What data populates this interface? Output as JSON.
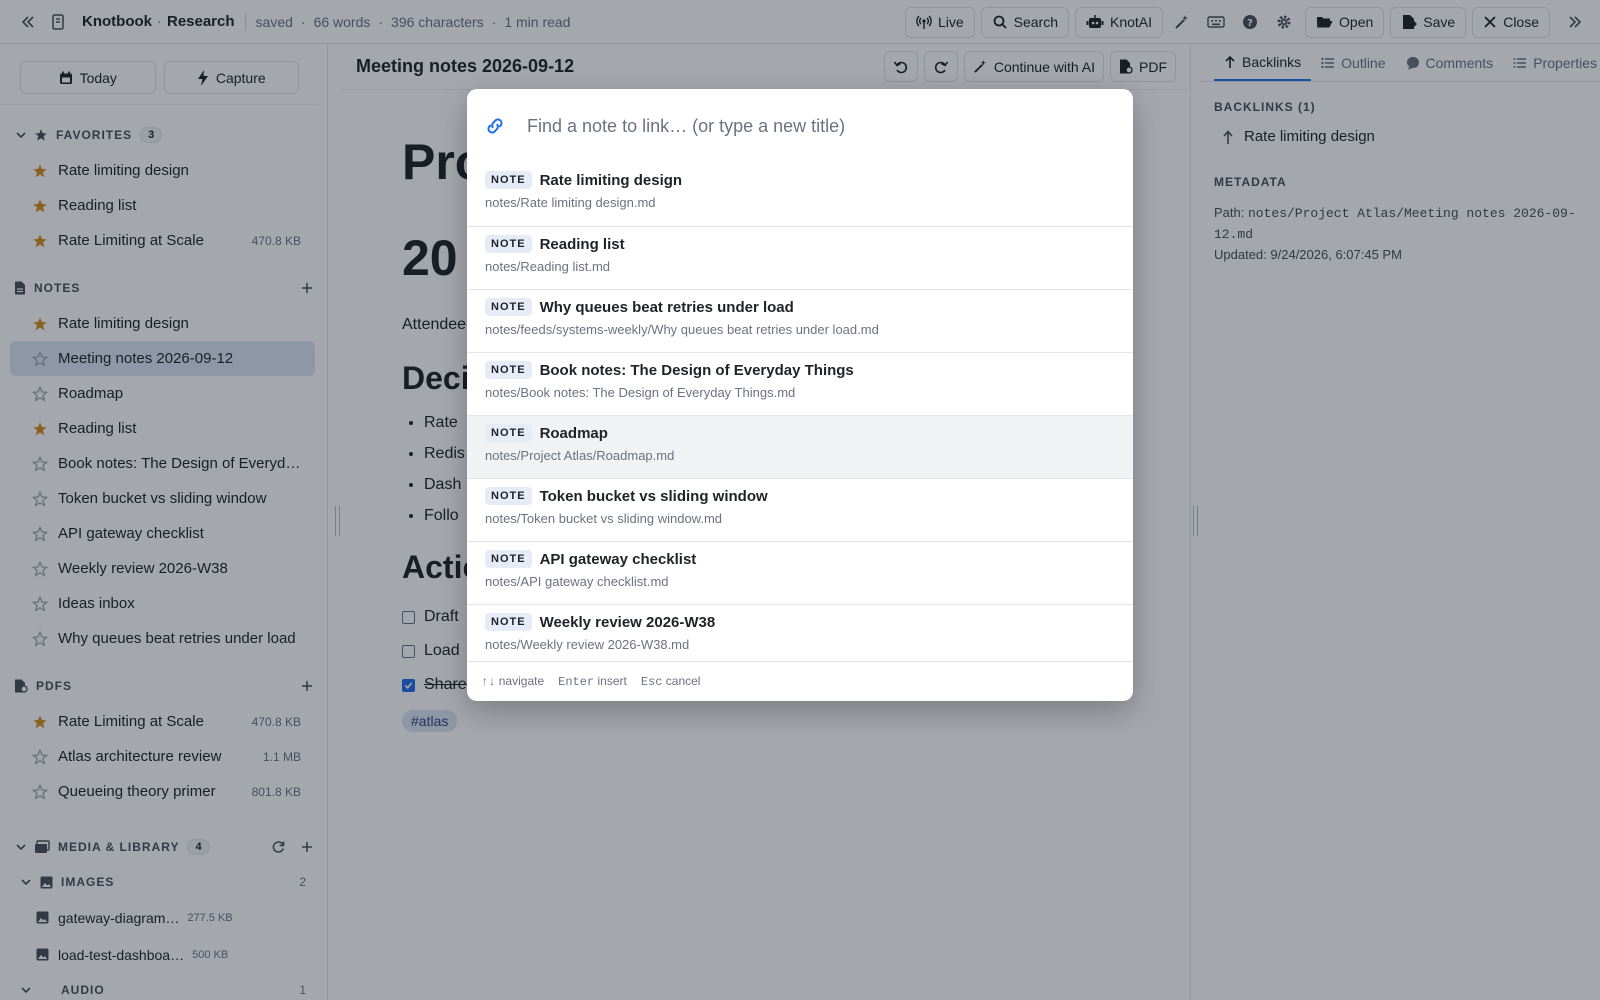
{
  "app": {
    "name": "Knotbook",
    "workspace": "Research",
    "stats": [
      "saved",
      "66 words",
      "396 characters",
      "1 min read"
    ]
  },
  "topbar": {
    "live_label": "Live",
    "search_label": "Search",
    "ai_label": "KnotAI",
    "open_label": "Open",
    "save_label": "Save",
    "close_label": "Close"
  },
  "sidebar": {
    "today_label": "Today",
    "capture_label": "Capture",
    "favorites": {
      "title": "FAVORITES",
      "count": "3",
      "items": [
        {
          "label": "Rate limiting design",
          "size": "",
          "starred": true
        },
        {
          "label": "Reading list",
          "size": "",
          "starred": true
        },
        {
          "label": "Rate Limiting at Scale",
          "size": "470.8 KB",
          "starred": true
        }
      ]
    },
    "notes": {
      "title": "NOTES",
      "items": [
        {
          "label": "Rate limiting design",
          "starred": true
        },
        {
          "label": "Meeting notes 2026-09-12",
          "starred": false,
          "active": true
        },
        {
          "label": "Roadmap",
          "starred": false
        },
        {
          "label": "Reading list",
          "starred": true
        },
        {
          "label": "Book notes: The Design of Everyday Things",
          "starred": false
        },
        {
          "label": "Token bucket vs sliding window",
          "starred": false
        },
        {
          "label": "API gateway checklist",
          "starred": false
        },
        {
          "label": "Weekly review 2026-W38",
          "starred": false
        },
        {
          "label": "Ideas inbox",
          "starred": false
        },
        {
          "label": "Why queues beat retries under load",
          "starred": false
        }
      ]
    },
    "pdfs": {
      "title": "PDFS",
      "items": [
        {
          "label": "Rate Limiting at Scale",
          "size": "470.8 KB",
          "starred": true
        },
        {
          "label": "Atlas architecture review",
          "size": "1.1 MB",
          "starred": false
        },
        {
          "label": "Queueing theory primer",
          "size": "801.8 KB",
          "starred": false
        }
      ]
    },
    "media": {
      "title": "MEDIA & LIBRARY",
      "count": "4",
      "images": {
        "title": "IMAGES",
        "count": "2",
        "items": [
          {
            "label": "gateway-diagram…",
            "size": "277.5 KB"
          },
          {
            "label": "load-test-dashboa…",
            "size": "500 KB"
          }
        ]
      },
      "audio": {
        "title": "AUDIO",
        "count": "1"
      }
    }
  },
  "main": {
    "title": "Meeting notes 2026-09-12",
    "continue_ai_label": "Continue with AI",
    "pdf_label": "PDF",
    "doc": {
      "h1_line1": "Pro",
      "h1_line2": "20",
      "attendees": "Attendee",
      "decisions_heading": "Deci",
      "bullets": [
        "Rate",
        "Redis",
        "Dash",
        "Follo"
      ],
      "actions_heading": "Actio",
      "tasks": [
        {
          "label": "Draft",
          "done": false
        },
        {
          "label": "Load",
          "done": false
        },
        {
          "label": "Share",
          "done": true
        }
      ],
      "tag": "#atlas"
    }
  },
  "right_panel": {
    "tabs": [
      "Backlinks",
      "Outline",
      "Comments",
      "Properties"
    ],
    "backlinks_title": "BACKLINKS (1)",
    "backlinks": [
      "Rate limiting design"
    ],
    "metadata_title": "METADATA",
    "path_label": "Path:",
    "path_value": "notes/Project Atlas/Meeting notes 2026-09-12.md",
    "updated_label": "Updated:",
    "updated_value": "9/24/2026, 6:07:45 PM"
  },
  "link_modal": {
    "placeholder": "Find a note to link… (or type a new title)",
    "results": [
      {
        "kind": "NOTE",
        "title": "Rate limiting design",
        "path": "notes/Rate limiting design.md"
      },
      {
        "kind": "NOTE",
        "title": "Reading list",
        "path": "notes/Reading list.md"
      },
      {
        "kind": "NOTE",
        "title": "Why queues beat retries under load",
        "path": "notes/feeds/systems-weekly/Why queues beat retries under load.md"
      },
      {
        "kind": "NOTE",
        "title": "Book notes: The Design of Everyday Things",
        "path": "notes/Book notes: The Design of Everyday Things.md"
      },
      {
        "kind": "NOTE",
        "title": "Roadmap",
        "path": "notes/Project Atlas/Roadmap.md",
        "highlighted": true
      },
      {
        "kind": "NOTE",
        "title": "Token bucket vs sliding window",
        "path": "notes/Token bucket vs sliding window.md"
      },
      {
        "kind": "NOTE",
        "title": "API gateway checklist",
        "path": "notes/API gateway checklist.md"
      },
      {
        "kind": "NOTE",
        "title": "Weekly review 2026-W38",
        "path": "notes/Weekly review 2026-W38.md"
      }
    ],
    "footer": {
      "nav_key": "↑↓",
      "nav_label": "navigate",
      "insert_key": "Enter",
      "insert_label": "insert",
      "cancel_key": "Esc",
      "cancel_label": "cancel"
    }
  },
  "colors": {
    "accent": "#1f6feb",
    "star": "#d4901a",
    "active_row": "#dbe5f3"
  }
}
